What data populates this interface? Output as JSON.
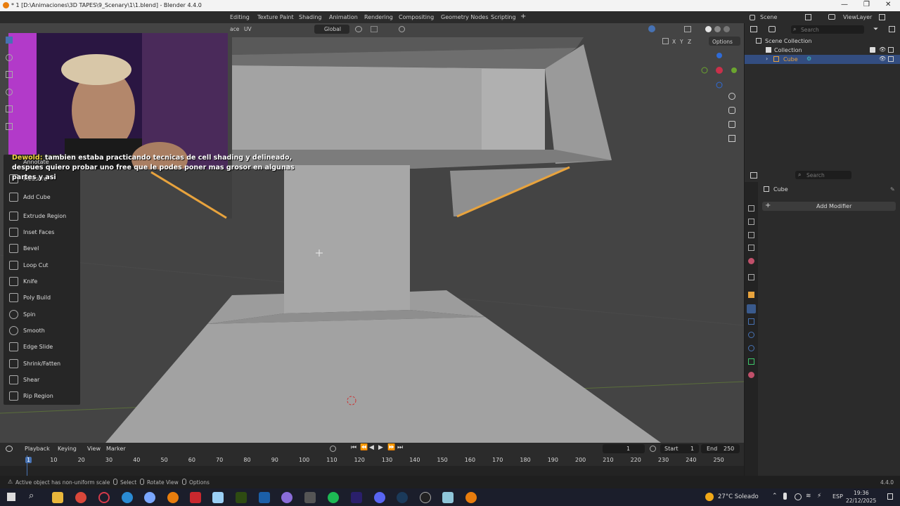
{
  "window": {
    "title": "* 1 [D:\\Animaciones\\3D TAPES\\9_Scenary\\1\\1.blend] - Blender 4.4.0"
  },
  "topbar": {
    "workspaces": [
      "Editing",
      "Texture Paint",
      "Shading",
      "Animation",
      "Rendering",
      "Compositing",
      "Geometry Nodes",
      "Scripting"
    ],
    "add_tab": "+",
    "scene": "Scene",
    "view_layer": "ViewLayer"
  },
  "viewport_header": {
    "face": "ace",
    "uv": "UV",
    "orientation": "Global",
    "options": "Options",
    "axes": [
      "X",
      "Y",
      "Z"
    ]
  },
  "toolbar": {
    "annotate": "Annotate",
    "tools": [
      "Measure",
      "Add Cube",
      "Extrude Region",
      "Inset Faces",
      "Bevel",
      "Loop Cut",
      "Knife",
      "Poly Build",
      "Spin",
      "Smooth",
      "Edge Slide",
      "Shrink/Fatten",
      "Shear",
      "Rip Region"
    ]
  },
  "chat": {
    "user": "Dewold:",
    "message": "tambien estaba practicando tecnicas de cell shading y delineado, despues quiero probar uno free que le podes poner mas grosor en algunas partes y asi"
  },
  "outliner": {
    "search_placeholder": "Search",
    "scene_collection": "Scene Collection",
    "collection": "Collection",
    "object": "Cube"
  },
  "properties": {
    "search_placeholder": "Search",
    "object_name": "Cube",
    "add_modifier": "Add Modifier"
  },
  "timeline": {
    "menus": [
      "Playback",
      "Keying",
      "View",
      "Marker"
    ],
    "current_frame": "1",
    "start_label": "Start",
    "start": "1",
    "end_label": "End",
    "end": "250",
    "ticks": [
      "1",
      "10",
      "20",
      "30",
      "40",
      "50",
      "60",
      "70",
      "80",
      "90",
      "100",
      "110",
      "120",
      "130",
      "140",
      "150",
      "160",
      "170",
      "180",
      "190",
      "200",
      "210",
      "220",
      "230",
      "240",
      "250"
    ]
  },
  "statusbar": {
    "message": "Active object has non-uniform scale",
    "select": "Select",
    "rotate": "Rotate View",
    "options": "Options",
    "version": "4.4.0"
  },
  "taskbar": {
    "weather": "27°C  Soleado",
    "lang": "ESP",
    "time": "19:36",
    "date": "22/12/2025"
  },
  "colors": {
    "accent": "#4772b3",
    "selected_edge": "#e8a33d",
    "object_orange": "#e8a33d",
    "viewport_bg": "#444444"
  }
}
